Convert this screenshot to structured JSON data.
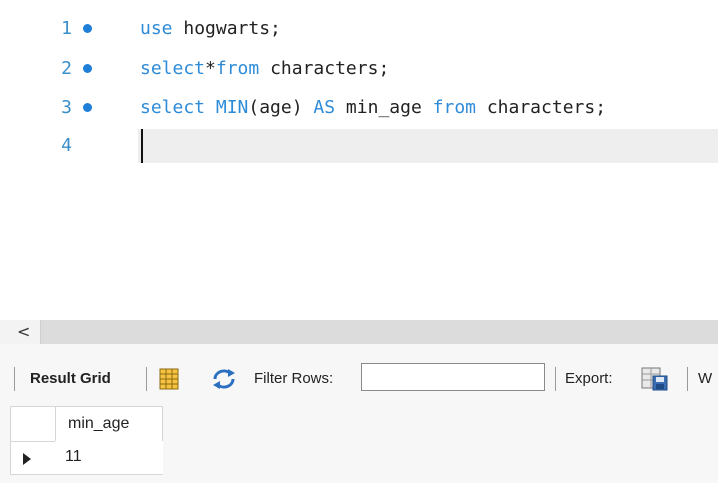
{
  "editor": {
    "lines": [
      {
        "number": "1",
        "tokens": [
          {
            "t": "use",
            "k": "kw"
          },
          {
            "t": " hogwarts;",
            "k": ""
          }
        ]
      },
      {
        "number": "2",
        "tokens": [
          {
            "t": "select",
            "k": "kw"
          },
          {
            "t": "*",
            "k": ""
          },
          {
            "t": "from",
            "k": "kw"
          },
          {
            "t": " characters;",
            "k": ""
          }
        ]
      },
      {
        "number": "3",
        "tokens": [
          {
            "t": "select ",
            "k": "kw"
          },
          {
            "t": "MIN",
            "k": "fn"
          },
          {
            "t": "(age) ",
            "k": ""
          },
          {
            "t": "AS",
            "k": "kw"
          },
          {
            "t": " min_age ",
            "k": ""
          },
          {
            "t": "from",
            "k": "kw"
          },
          {
            "t": " characters;",
            "k": ""
          }
        ]
      },
      {
        "number": "4",
        "tokens": []
      }
    ]
  },
  "scrollbar": {
    "left_arrow": "<"
  },
  "toolbar": {
    "result_grid_label": "Result Grid",
    "filter_rows_label": "Filter Rows:",
    "filter_value": "",
    "export_label": "Export:",
    "wrap_label": "W"
  },
  "grid": {
    "columns": [
      "min_age"
    ],
    "rows": [
      [
        "11"
      ]
    ]
  },
  "colors": {
    "keyword": "#2e8bd8",
    "line_number": "#3a8fc9",
    "breakpoint_dot": "#1e7ed8"
  }
}
